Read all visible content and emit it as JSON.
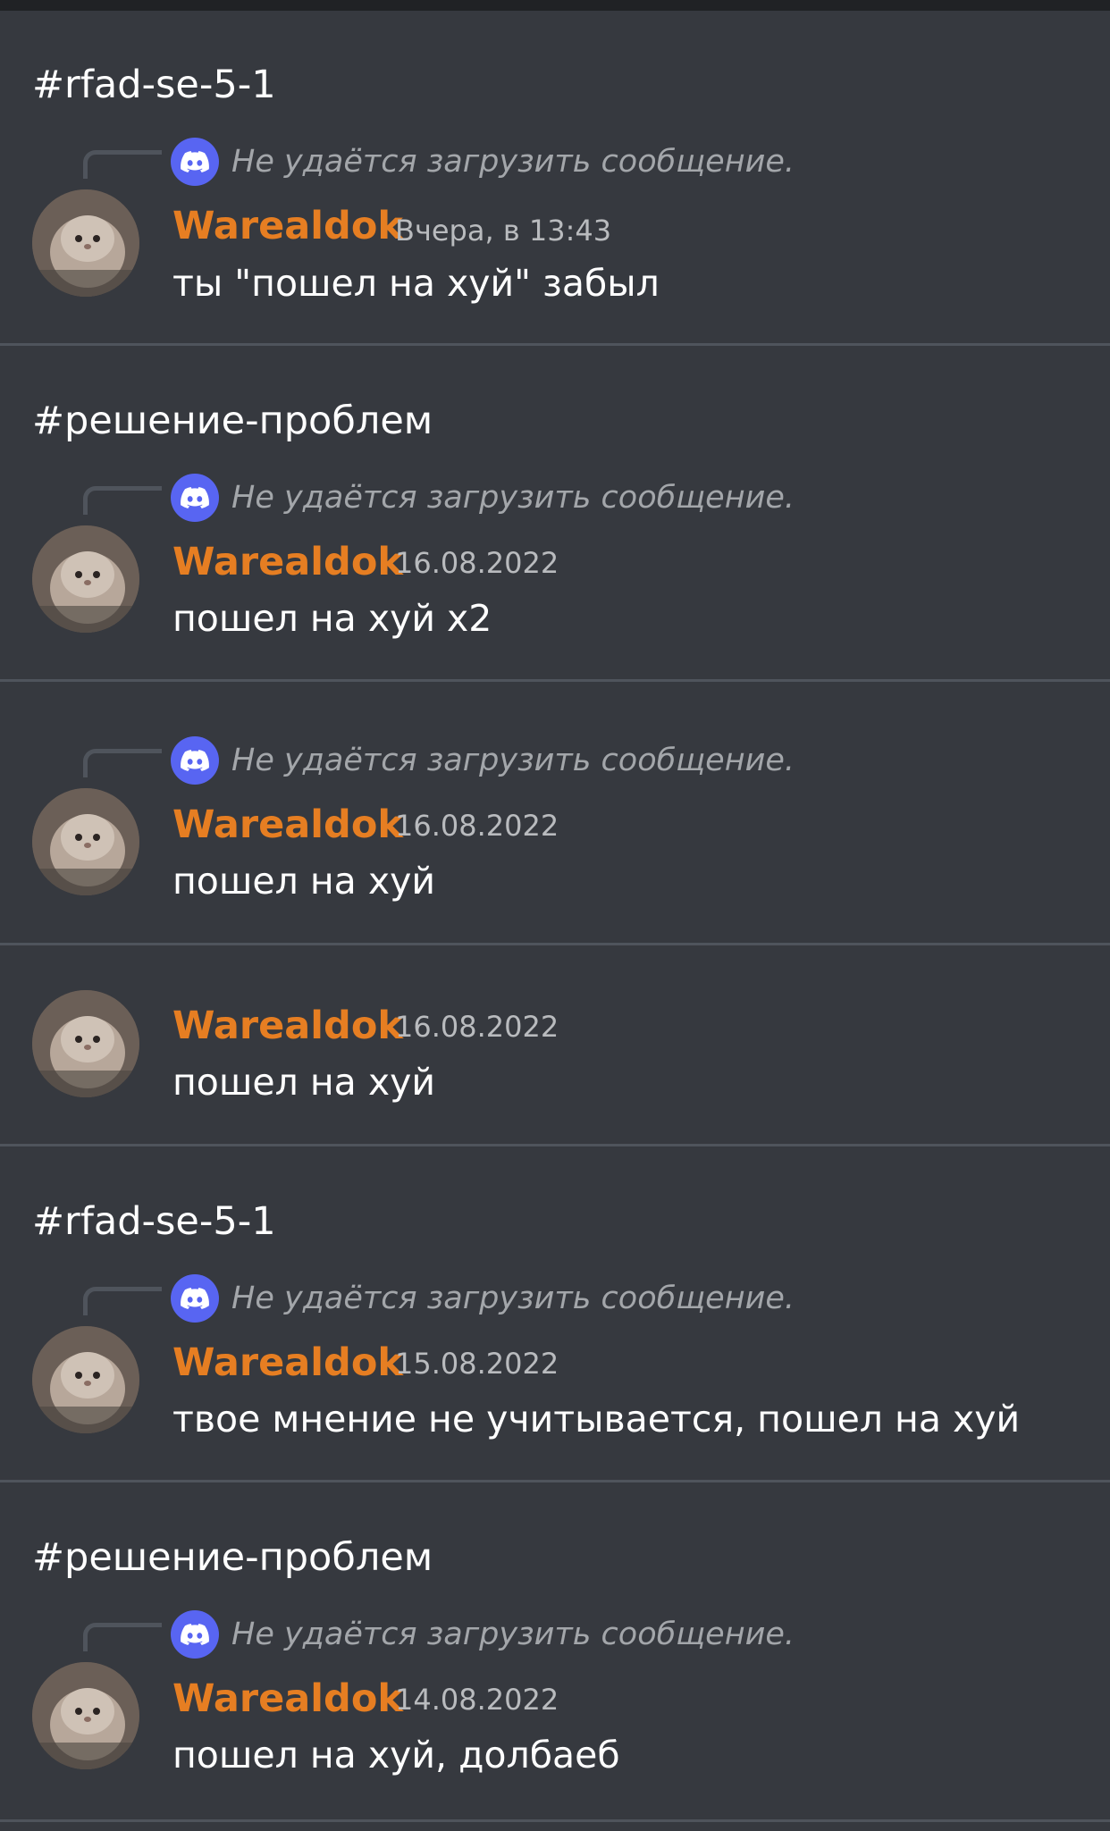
{
  "theme": {
    "background": "#36393f",
    "divider": "#4f545c",
    "author_color": "#e67e22",
    "reply_icon_bg": "#5865f2"
  },
  "items": [
    {
      "channel": "#rfad-se-5-1",
      "reply_text": "Не удаётся загрузить сообщение.",
      "author": "Warealdok",
      "timestamp": "Вчера, в 13:43",
      "content": "ты \"пошел на хуй\" забыл"
    },
    {
      "channel": "#решение-проблем",
      "reply_text": "Не удаётся загрузить сообщение.",
      "author": "Warealdok",
      "timestamp": "16.08.2022",
      "content": "пошел на хуй x2"
    },
    {
      "channel": "",
      "reply_text": "Не удаётся загрузить сообщение.",
      "author": "Warealdok",
      "timestamp": "16.08.2022",
      "content": "пошел на хуй"
    },
    {
      "channel": "",
      "reply_text": "",
      "author": "Warealdok",
      "timestamp": "16.08.2022",
      "content": "пошел на хуй"
    },
    {
      "channel": "#rfad-se-5-1",
      "reply_text": "Не удаётся загрузить сообщение.",
      "author": "Warealdok",
      "timestamp": "15.08.2022",
      "content": "твое мнение не учитывается, пошел на хуй"
    },
    {
      "channel": "#решение-проблем",
      "reply_text": "Не удаётся загрузить сообщение.",
      "author": "Warealdok",
      "timestamp": "14.08.2022",
      "content": "пошел на хуй, долбаеб"
    }
  ]
}
